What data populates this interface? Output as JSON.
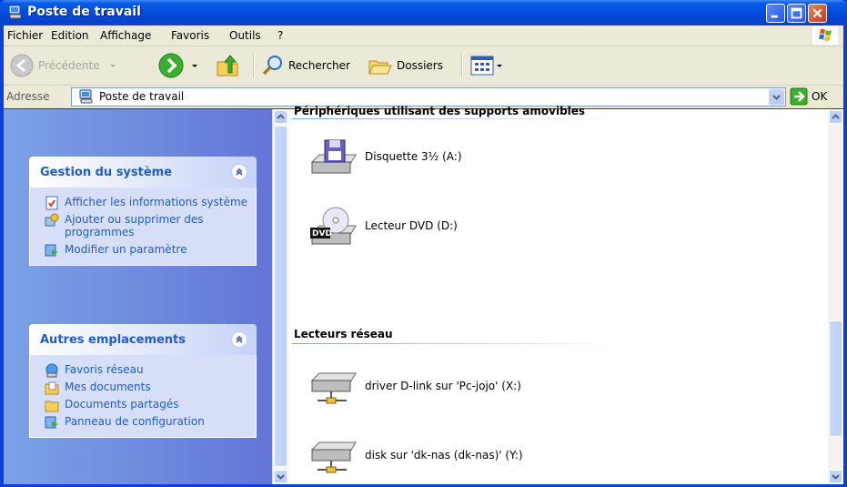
{
  "window": {
    "title": "Poste de travail",
    "colors": {
      "titlebar": "#0550e0",
      "chrome": "#ece9d8",
      "taskpane": "#6f8edf",
      "link": "#215dc6"
    }
  },
  "menu": {
    "items": [
      "Fichier",
      "Edition",
      "Affichage",
      "Favoris",
      "Outils",
      "?"
    ]
  },
  "toolbar": {
    "back_label": "Précédente",
    "search_label": "Rechercher",
    "folders_label": "Dossiers"
  },
  "address": {
    "label": "Adresse",
    "value": "Poste de travail",
    "go_label": "OK"
  },
  "taskpane": {
    "system": {
      "title": "Gestion du système",
      "tasks": [
        "Afficher les informations système",
        "Ajouter ou supprimer des programmes",
        "Modifier un paramètre"
      ]
    },
    "places": {
      "title": "Autres emplacements",
      "tasks": [
        "Favoris réseau",
        "Mes documents",
        "Documents partagés",
        "Panneau de configuration"
      ]
    }
  },
  "main": {
    "removable_header": "Périphériques utilisant des supports amovibles",
    "removable": [
      {
        "label": "Disquette 3½ (A:)",
        "icon": "floppy-drive-icon"
      },
      {
        "label": "Lecteur DVD (D:)",
        "icon": "dvd-drive-icon"
      }
    ],
    "network_header": "Lecteurs réseau",
    "network": [
      {
        "label": "driver D-link sur 'Pc-jojo' (X:)",
        "icon": "network-drive-icon"
      },
      {
        "label": "disk sur 'dk-nas (dk-nas)' (Y:)",
        "icon": "network-drive-icon"
      }
    ]
  }
}
